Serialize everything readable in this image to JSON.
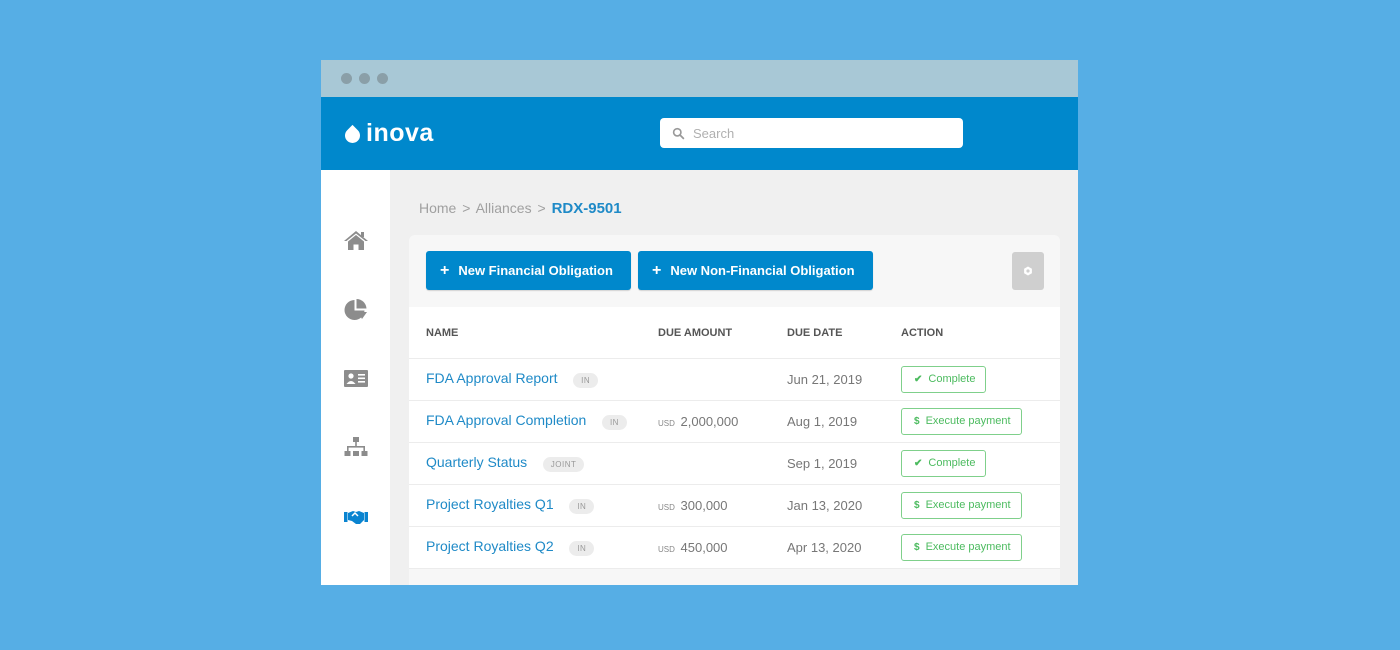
{
  "window": {
    "controls": [
      "dot",
      "dot",
      "dot"
    ]
  },
  "header": {
    "logo": "inova",
    "search": {
      "placeholder": "Search",
      "value": ""
    }
  },
  "sidebar": {
    "items": [
      {
        "name": "home",
        "icon": "home-icon",
        "active": false
      },
      {
        "name": "analytics",
        "icon": "pie-chart-icon",
        "active": false
      },
      {
        "name": "contacts",
        "icon": "id-card-icon",
        "active": false
      },
      {
        "name": "organization",
        "icon": "sitemap-icon",
        "active": false
      },
      {
        "name": "alliances",
        "icon": "handshake-icon",
        "active": true
      }
    ]
  },
  "breadcrumb": {
    "items": [
      "Home",
      "Alliances"
    ],
    "separator": ">",
    "current": "RDX-9501"
  },
  "toolbar": {
    "new_financial_label": "New Financial Obligation",
    "new_nonfinancial_label": "New Non-Financial Obligation",
    "plus": "+",
    "settings_icon": "gear-icon"
  },
  "table": {
    "columns": [
      "NAME",
      "DUE AMOUNT",
      "DUE DATE",
      "ACTION"
    ],
    "rows": [
      {
        "name": "FDA Approval Report",
        "tag": "IN",
        "currency": "",
        "amount": "",
        "due_date": "Jun 21, 2019",
        "action": "Complete",
        "action_icon": "✔"
      },
      {
        "name": "FDA Approval Completion",
        "tag": "IN",
        "currency": "USD",
        "amount": "2,000,000",
        "due_date": "Aug 1, 2019",
        "action": "Execute payment",
        "action_icon": "$"
      },
      {
        "name": "Quarterly Status",
        "tag": "JOINT",
        "currency": "",
        "amount": "",
        "due_date": "Sep 1, 2019",
        "action": "Complete",
        "action_icon": "✔"
      },
      {
        "name": "Project Royalties Q1",
        "tag": "IN",
        "currency": "USD",
        "amount": "300,000",
        "due_date": "Jan 13, 2020",
        "action": "Execute payment",
        "action_icon": "$"
      },
      {
        "name": "Project Royalties Q2",
        "tag": "IN",
        "currency": "USD",
        "amount": "450,000",
        "due_date": "Apr 13, 2020",
        "action": "Execute payment",
        "action_icon": "$"
      }
    ]
  },
  "colors": {
    "background": "#56aee5",
    "brand": "#0088cc",
    "link": "#1f8ac7",
    "action_green": "#4cbb5f",
    "sidebar_icon": "#8c8c8c"
  }
}
